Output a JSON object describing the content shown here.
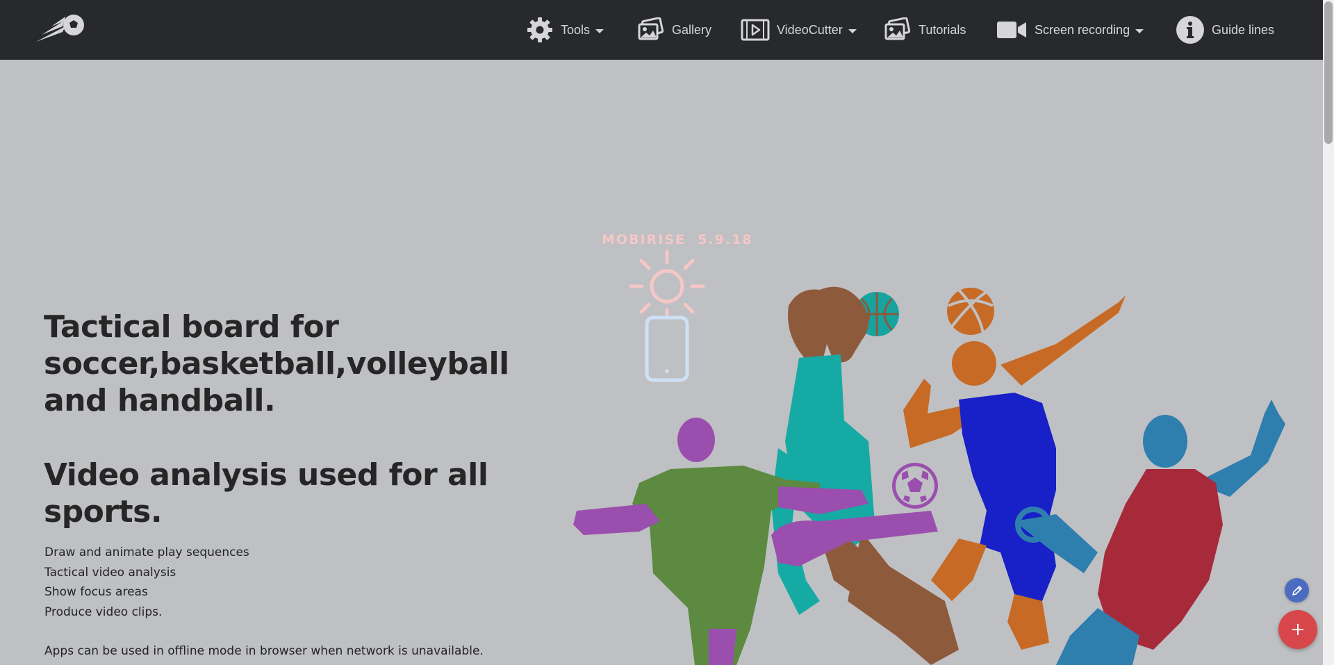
{
  "nav": {
    "items": [
      {
        "label": "Tools",
        "icon": "gear-icon",
        "dropdown": true
      },
      {
        "label": "Gallery",
        "icon": "images-icon",
        "dropdown": false
      },
      {
        "label": "VideoCutter",
        "icon": "video-play-icon",
        "dropdown": true
      },
      {
        "label": "Tutorials",
        "icon": "images-icon",
        "dropdown": false
      },
      {
        "label": "Screen recording",
        "icon": "video-camera-icon",
        "dropdown": true
      },
      {
        "label": "Guide lines",
        "icon": "info-icon",
        "dropdown": false
      }
    ]
  },
  "hero": {
    "title": "Tactical board for soccer,basketball,volleyball and handball.",
    "subtitle": "Video analysis used for all sports.",
    "features": [
      "Draw and animate play sequences",
      "Tactical video analysis",
      "Show focus areas",
      "Produce video clips."
    ],
    "offline_note": "Apps can be used in offline mode in browser when network is unavailable."
  },
  "badge": {
    "text": "MOBIRISE  5.9.18"
  },
  "colors": {
    "navbar_bg": "#27292d",
    "page_bg": "#bfc0c3",
    "nav_text": "#d6d6d8",
    "fab_add": "#d7464b",
    "fab_edit": "#4b6cc1",
    "badge_pink": "#f5c7c7",
    "phone_blue": "#cfe0f5"
  }
}
